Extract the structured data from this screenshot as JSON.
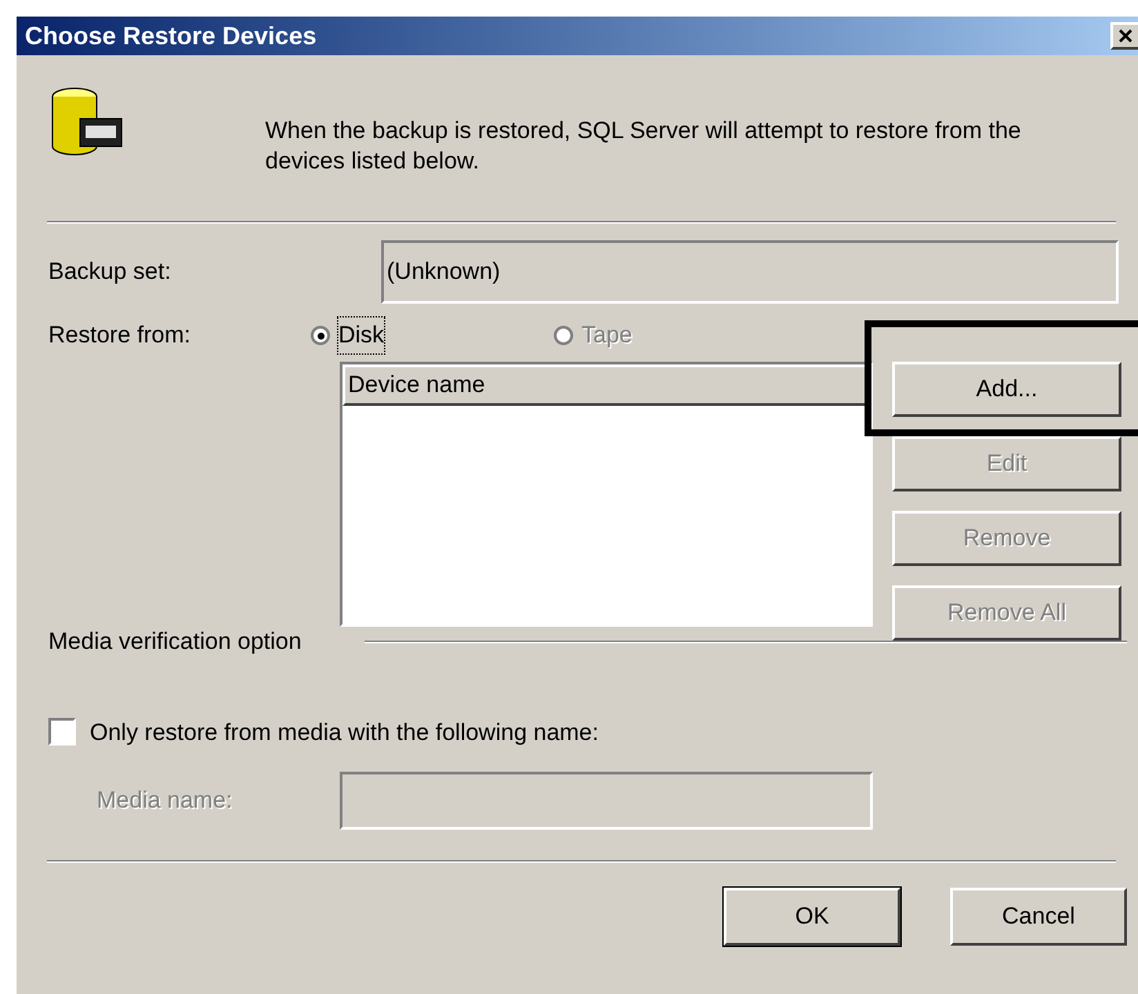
{
  "window": {
    "title": "Choose Restore Devices"
  },
  "description": "When the backup is restored, SQL Server will attempt to restore from the devices listed below.",
  "backup_set": {
    "label": "Backup set:",
    "value": "(Unknown)"
  },
  "restore_from": {
    "label": "Restore from:",
    "options": [
      {
        "label": "Disk",
        "selected": true,
        "disabled": false
      },
      {
        "label": "Tape",
        "selected": false,
        "disabled": true
      }
    ]
  },
  "device_list": {
    "columns": [
      "Device name"
    ]
  },
  "device_buttons": [
    {
      "label": "Add...",
      "disabled": false,
      "highlighted": true
    },
    {
      "label": "Edit",
      "disabled": true,
      "highlighted": false
    },
    {
      "label": "Remove",
      "disabled": true,
      "highlighted": false
    },
    {
      "label": "Remove All",
      "disabled": true,
      "highlighted": false
    }
  ],
  "media_verification": {
    "title": "Media verification option",
    "checkbox": {
      "label": "Only restore from media with the following name:",
      "checked": false
    },
    "media_name": {
      "label": "Media name:",
      "disabled": true
    }
  },
  "footer_buttons": [
    {
      "label": "OK",
      "default": true
    },
    {
      "label": "Cancel",
      "default": false
    }
  ]
}
